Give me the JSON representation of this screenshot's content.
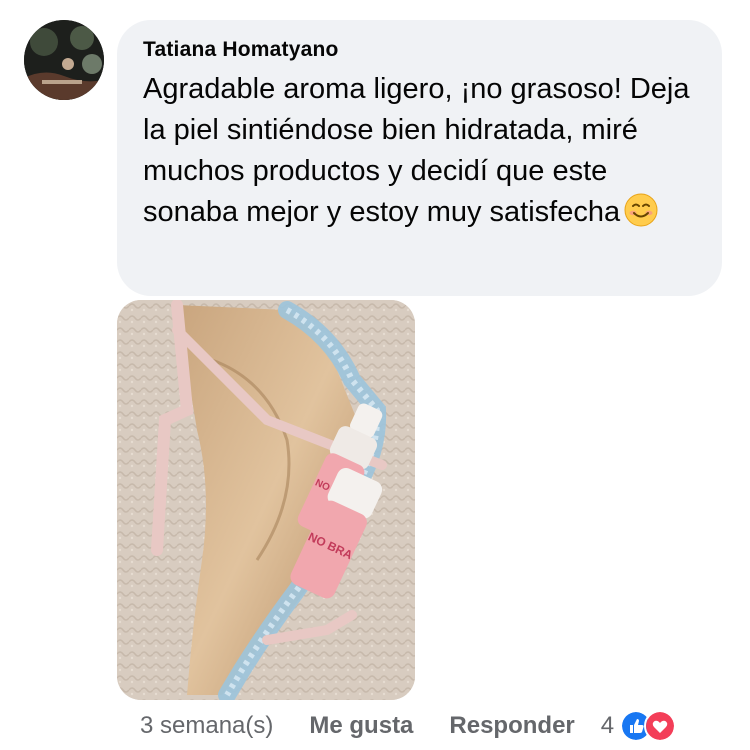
{
  "comment": {
    "author": "Tatiana Homatyano",
    "text": "Agradable aroma ligero, ¡no grasoso! Deja la piel sintiéndose bien hidratada, miré muchos productos y decidí que este sonaba mejor y estoy muy satisfecha",
    "emoji": "smiling-face-emoji",
    "photo_product_label": "NO BRA"
  },
  "actions": {
    "timestamp": "3 semana(s)",
    "like_label": "Me gusta",
    "reply_label": "Responder",
    "reaction_count": "4"
  },
  "colors": {
    "bubble_bg": "#f0f2f5",
    "meta_text": "#65676b",
    "like_blue": "#1877f2",
    "love_red": "#f33e58"
  }
}
